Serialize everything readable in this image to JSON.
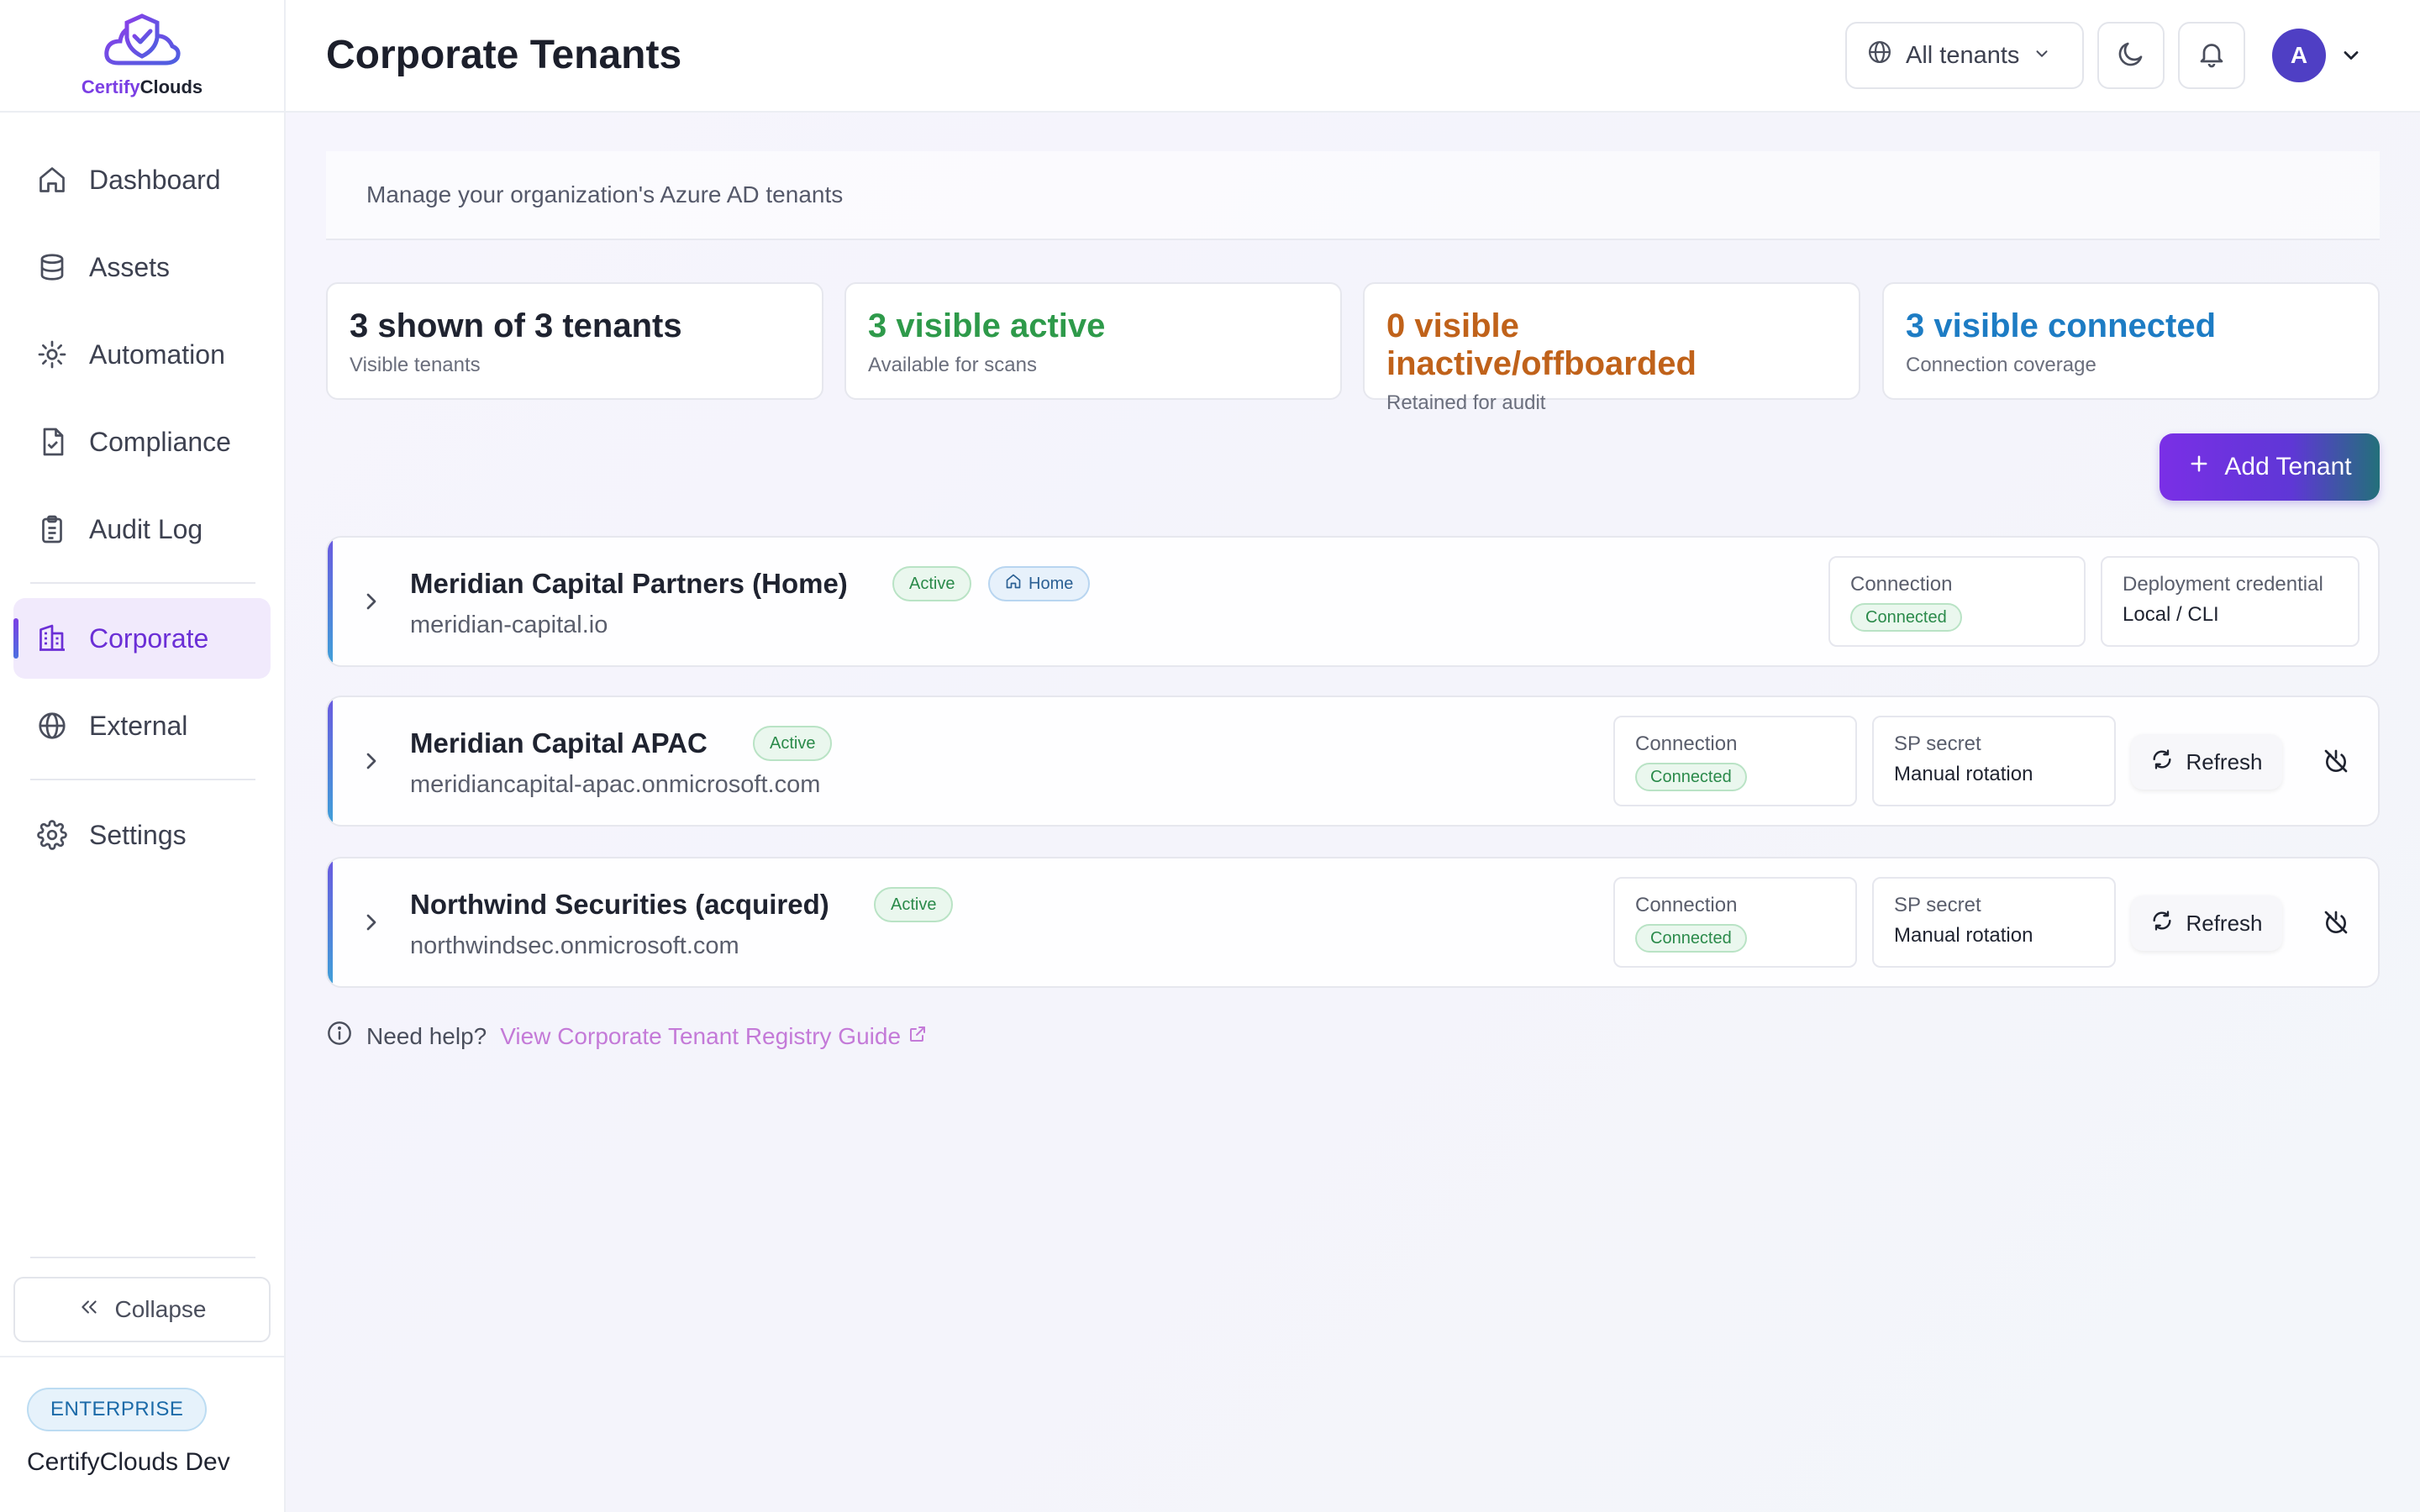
{
  "brand": {
    "name_a": "Certify",
    "name_b": "Clouds"
  },
  "sidebar": {
    "items": [
      {
        "label": "Dashboard"
      },
      {
        "label": "Assets"
      },
      {
        "label": "Automation"
      },
      {
        "label": "Compliance"
      },
      {
        "label": "Audit Log"
      },
      {
        "label": "Corporate"
      },
      {
        "label": "External"
      },
      {
        "label": "Settings"
      }
    ],
    "active_item": "Corporate",
    "collapse_label": "Collapse",
    "plan_badge": "ENTERPRISE",
    "org_name": "CertifyClouds Dev"
  },
  "header": {
    "title": "Corporate Tenants",
    "tenant_filter": "All tenants",
    "avatar_initial": "A"
  },
  "main": {
    "subtitle": "Manage your organization's Azure AD tenants",
    "stats": [
      {
        "value": "3 shown of 3 tenants",
        "caption": "Visible tenants",
        "color": "#1f2330"
      },
      {
        "value": "3 visible active",
        "caption": "Available for scans",
        "color": "#2e9a4a"
      },
      {
        "value": "0 visible inactive/offboarded",
        "caption": "Retained for audit",
        "color": "#c0621a"
      },
      {
        "value": "3 visible connected",
        "caption": "Connection coverage",
        "color": "#1d7cc4"
      }
    ],
    "add_button": "Add Tenant",
    "tenants": [
      {
        "name": "Meridian Capital Partners (Home)",
        "domain": "meridian-capital.io",
        "status": "Active",
        "home_badge": "Home",
        "connection_label": "Connection",
        "connection_status": "Connected",
        "credential_label": "Deployment credential",
        "credential_value": "Local / CLI"
      },
      {
        "name": "Meridian Capital APAC",
        "domain": "meridiancapital-apac.onmicrosoft.com",
        "status": "Active",
        "connection_label": "Connection",
        "connection_status": "Connected",
        "credential_label": "SP secret",
        "credential_value": "Manual rotation",
        "refresh_label": "Refresh"
      },
      {
        "name": "Northwind Securities (acquired)",
        "domain": "northwindsec.onmicrosoft.com",
        "status": "Active",
        "connection_label": "Connection",
        "connection_status": "Connected",
        "credential_label": "SP secret",
        "credential_value": "Manual rotation",
        "refresh_label": "Refresh"
      }
    ],
    "help": {
      "question": "Need help?",
      "link": "View Corporate Tenant Registry Guide"
    }
  },
  "colors": {
    "accent": "#7b3fe4",
    "connected": "#2a8a4a"
  }
}
